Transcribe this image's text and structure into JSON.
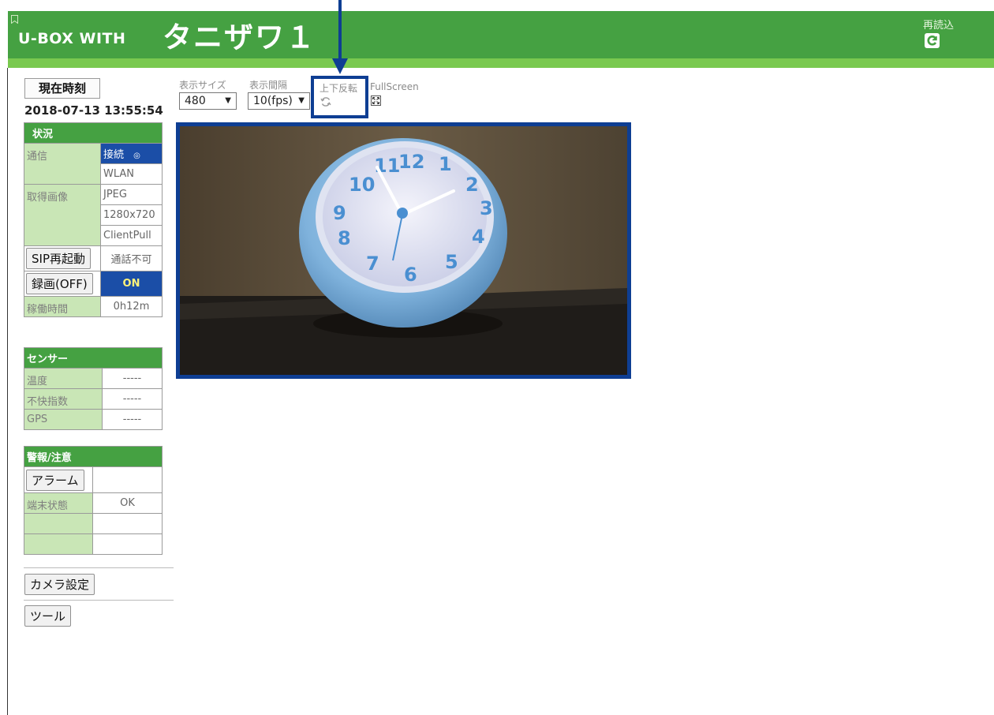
{
  "header": {
    "app_name": "U-BOX WITH",
    "device_name": "タニザワ１",
    "reload_label": "再読込",
    "bookmark_icon": "bookmark-icon",
    "reload_icon": "reload-icon"
  },
  "clock": {
    "label": "現在時刻",
    "value": "2018-07-13 13:55:54"
  },
  "status": {
    "title": "状況",
    "rows": [
      {
        "label": "通信",
        "value": "接続"
      },
      {
        "label": "",
        "value": "WLAN"
      },
      {
        "label": "取得画像",
        "value": "JPEG"
      },
      {
        "label": "",
        "value": "1280x720"
      },
      {
        "label": "",
        "value": "ClientPull"
      }
    ],
    "sip_button": "SIP再起動",
    "sip_status": "通話不可",
    "record_button": "録画(OFF)",
    "record_status": "ON",
    "uptime_label": "稼働時間",
    "uptime_value": "0h12m"
  },
  "sensor": {
    "title": "センサー",
    "rows": [
      {
        "label": "温度",
        "value": "-----"
      },
      {
        "label": "不快指数",
        "value": "-----"
      },
      {
        "label": "GPS",
        "value": "-----"
      }
    ]
  },
  "alarm": {
    "title": "警報/注意",
    "alarm_button": "アラーム",
    "terminal_label": "端末状態",
    "terminal_value": "OK"
  },
  "buttons": {
    "camera_settings": "カメラ設定",
    "tools": "ツール"
  },
  "controls": {
    "size_label": "表示サイズ",
    "size_value": "480",
    "interval_label": "表示間隔",
    "interval_value": "10(fps)",
    "flip_label": "上下反転",
    "fullscreen_label": "FullScreen"
  },
  "colors": {
    "header_green": "#45a142",
    "strip_green": "#79c94f",
    "table_label_green": "#c9e6b6",
    "highlight_blue": "#1b4ea7",
    "annotation_blue": "#0e3e93"
  }
}
